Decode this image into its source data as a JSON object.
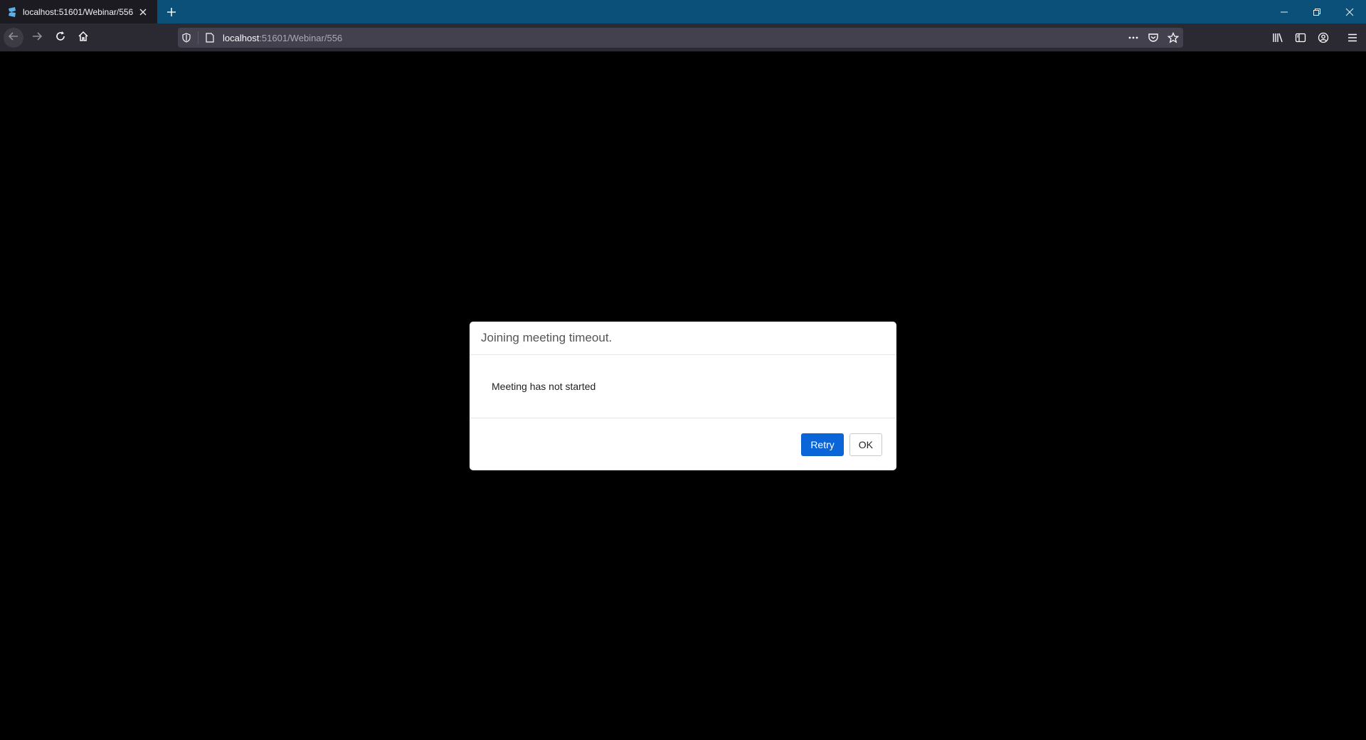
{
  "browser": {
    "tab": {
      "title": "localhost:51601/Webinar/556",
      "favicon": "app-favicon-icon"
    },
    "url": {
      "host": "localhost",
      "path": ":51601/Webinar/556"
    },
    "colors": {
      "tabstrip": "#0b5078",
      "toolbar": "#2b2a33",
      "urlbar": "#42414d"
    }
  },
  "modal": {
    "title": "Joining meeting timeout.",
    "message": "Meeting has not started",
    "buttons": {
      "retry": "Retry",
      "ok": "OK"
    },
    "colors": {
      "primary": "#0a66d8"
    }
  }
}
